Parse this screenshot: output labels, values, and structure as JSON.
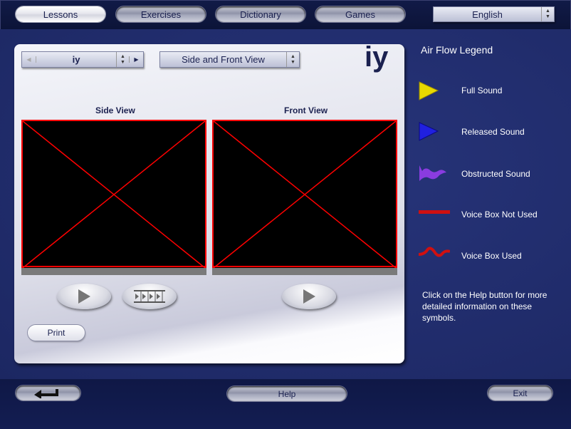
{
  "nav": {
    "tabs": [
      {
        "label": "Lessons",
        "active": true
      },
      {
        "label": "Exercises"
      },
      {
        "label": "Dictionary"
      },
      {
        "label": "Games"
      }
    ],
    "language": "English"
  },
  "lesson": {
    "sound_select": "iy",
    "view_select": "Side and Front View",
    "sound_display": "iy",
    "side_view_label": "Side View",
    "front_view_label": "Front View",
    "print_label": "Print"
  },
  "legend": {
    "title": "Air Flow Legend",
    "items": [
      {
        "label": "Full Sound",
        "icon": "yellow-triangle-icon",
        "color": "#e8d800"
      },
      {
        "label": "Released Sound",
        "icon": "blue-triangle-icon",
        "color": "#2020e0"
      },
      {
        "label": "Obstructed Sound",
        "icon": "purple-wave-icon",
        "color": "#8a3ce0"
      },
      {
        "label": "Voice Box Not Used",
        "icon": "red-line-icon",
        "color": "#d01010"
      },
      {
        "label": "Voice Box Used",
        "icon": "red-wave-icon",
        "color": "#d01010"
      }
    ],
    "help_text": "Click on the Help button for more detailed information on these symbols."
  },
  "footer": {
    "help_label": "Help",
    "exit_label": "Exit"
  }
}
